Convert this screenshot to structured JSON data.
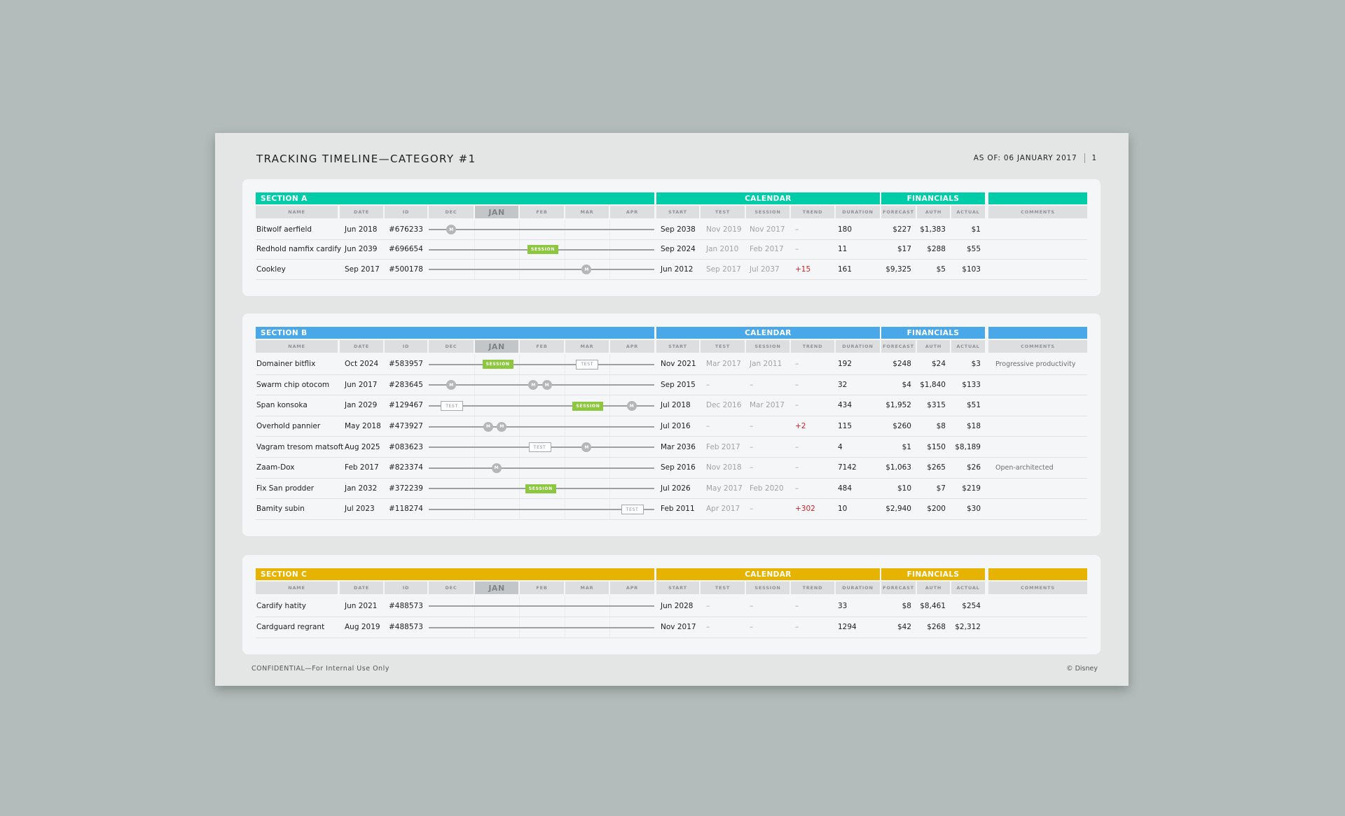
{
  "header": {
    "title": "TRACKING TIMELINE—CATEGORY #1",
    "as_of": "AS OF: 06 JANUARY 2017",
    "page_number": "1"
  },
  "group_headers": {
    "calendar": "CALENDAR",
    "financials": "FINANCIALS"
  },
  "columns": {
    "name": "NAME",
    "date": "DATE",
    "id": "ID",
    "months": [
      "DEC",
      "JAN",
      "FEB",
      "MAR",
      "APR"
    ],
    "start": "START",
    "test": "TEST",
    "session": "SESSION",
    "trend": "TREND",
    "duration": "DURATION",
    "forecast": "FORECAST",
    "auth": "AUTH",
    "actual": "ACTUAL",
    "comments": "COMMENTS"
  },
  "milestone_labels": {
    "m": "M",
    "session": "SESSION",
    "test": "TEST"
  },
  "sections": [
    {
      "title": "SECTION A",
      "color": "#00cca8",
      "rows": [
        {
          "name": "Bitwolf aerfield",
          "date": "Jun 2018",
          "id": "#676233",
          "markers": [
            {
              "type": "m",
              "month_pos": 0.5
            }
          ],
          "start": "Sep 2038",
          "test": "Nov 2019",
          "session": "Nov 2017",
          "trend": "–",
          "trend_alert": false,
          "duration": "180",
          "forecast": "$227",
          "auth": "$1,383",
          "actual": "$1",
          "comments": ""
        },
        {
          "name": "Redhold namfix cardify",
          "date": "Jun 2039",
          "id": "#696654",
          "markers": [
            {
              "type": "session",
              "month_pos": 2.5
            }
          ],
          "start": "Sep 2024",
          "test": "Jan 2010",
          "session": "Feb 2017",
          "trend": "–",
          "trend_alert": false,
          "duration": "11",
          "forecast": "$17",
          "auth": "$288",
          "actual": "$55",
          "comments": ""
        },
        {
          "name": "Cookley",
          "date": "Sep 2017",
          "id": "#500178",
          "markers": [
            {
              "type": "m",
              "month_pos": 3.5
            }
          ],
          "start": "Jun 2012",
          "test": "Sep 2017",
          "session": "Jul 2037",
          "trend": "+15",
          "trend_alert": true,
          "duration": "161",
          "forecast": "$9,325",
          "auth": "$5",
          "actual": "$103",
          "comments": ""
        }
      ]
    },
    {
      "title": "SECTION B",
      "color": "#4aa7e8",
      "rows": [
        {
          "name": "Domainer bitflix",
          "date": "Oct 2024",
          "id": "#583957",
          "markers": [
            {
              "type": "session",
              "month_pos": 1.5
            },
            {
              "type": "test",
              "month_pos": 3.5
            }
          ],
          "start": "Nov 2021",
          "test": "Mar 2017",
          "session": "Jan 2011",
          "trend": "–",
          "trend_alert": false,
          "duration": "192",
          "forecast": "$248",
          "auth": "$24",
          "actual": "$3",
          "comments": "Progressive productivity"
        },
        {
          "name": "Swarm chip otocom",
          "date": "Jun 2017",
          "id": "#283645",
          "markers": [
            {
              "type": "m",
              "month_pos": 0.5
            },
            {
              "type": "m",
              "month_pos": 2.32
            },
            {
              "type": "m",
              "month_pos": 2.62
            }
          ],
          "start": "Sep 2015",
          "test": "–",
          "session": "–",
          "trend": "–",
          "trend_alert": false,
          "duration": "32",
          "forecast": "$4",
          "auth": "$1,840",
          "actual": "$133",
          "comments": ""
        },
        {
          "name": "Span konsoka",
          "date": "Jan 2029",
          "id": "#129467",
          "markers": [
            {
              "type": "test",
              "month_pos": 0.5
            },
            {
              "type": "session",
              "month_pos": 3.5
            },
            {
              "type": "m",
              "month_pos": 4.5
            }
          ],
          "start": "Jul 2018",
          "test": "Dec 2016",
          "session": "Mar 2017",
          "trend": "–",
          "trend_alert": false,
          "duration": "434",
          "forecast": "$1,952",
          "auth": "$315",
          "actual": "$51",
          "comments": ""
        },
        {
          "name": "Overhold pannier",
          "date": "May 2018",
          "id": "#473927",
          "markers": [
            {
              "type": "m",
              "month_pos": 1.32
            },
            {
              "type": "m",
              "month_pos": 1.62
            }
          ],
          "start": "Jul 2016",
          "test": "–",
          "session": "–",
          "trend": "+2",
          "trend_alert": true,
          "duration": "115",
          "forecast": "$260",
          "auth": "$8",
          "actual": "$18",
          "comments": ""
        },
        {
          "name": "Vagram tresom matsoft",
          "date": "Aug 2025",
          "id": "#083623",
          "markers": [
            {
              "type": "test",
              "month_pos": 2.45
            },
            {
              "type": "m",
              "month_pos": 3.5
            }
          ],
          "start": "Mar 2036",
          "test": "Feb 2017",
          "session": "–",
          "trend": "–",
          "trend_alert": false,
          "duration": "4",
          "forecast": "$1",
          "auth": "$150",
          "actual": "$8,189",
          "comments": ""
        },
        {
          "name": "Zaam-Dox",
          "date": "Feb 2017",
          "id": "#823374",
          "markers": [
            {
              "type": "m",
              "month_pos": 1.5
            }
          ],
          "start": "Sep 2016",
          "test": "Nov 2018",
          "session": "–",
          "trend": "–",
          "trend_alert": false,
          "duration": "7142",
          "forecast": "$1,063",
          "auth": "$265",
          "actual": "$26",
          "comments": "Open-architected"
        },
        {
          "name": "Fix San prodder",
          "date": "Jan 2032",
          "id": "#372239",
          "markers": [
            {
              "type": "session",
              "month_pos": 2.45
            }
          ],
          "start": "Jul 2026",
          "test": "May 2017",
          "session": "Feb 2020",
          "trend": "–",
          "trend_alert": false,
          "duration": "484",
          "forecast": "$10",
          "auth": "$7",
          "actual": "$219",
          "comments": ""
        },
        {
          "name": "Bamity subin",
          "date": "Jul 2023",
          "id": "#118274",
          "markers": [
            {
              "type": "test",
              "month_pos": 4.5
            }
          ],
          "start": "Feb 2011",
          "test": "Apr 2017",
          "session": "–",
          "trend": "+302",
          "trend_alert": true,
          "duration": "10",
          "forecast": "$2,940",
          "auth": "$200",
          "actual": "$30",
          "comments": ""
        }
      ]
    },
    {
      "title": "SECTION C",
      "color": "#e6b400",
      "rows": [
        {
          "name": "Cardify hatity",
          "date": "Jun 2021",
          "id": "#488573",
          "markers": [],
          "start": "Jun 2028",
          "test": "–",
          "session": "–",
          "trend": "–",
          "trend_alert": false,
          "duration": "33",
          "forecast": "$8",
          "auth": "$8,461",
          "actual": "$254",
          "comments": ""
        },
        {
          "name": "Cardguard regrant",
          "date": "Aug 2019",
          "id": "#488573",
          "markers": [],
          "start": "Nov 2017",
          "test": "–",
          "session": "–",
          "trend": "–",
          "trend_alert": false,
          "duration": "1294",
          "forecast": "$42",
          "auth": "$268",
          "actual": "$2,312",
          "comments": ""
        }
      ]
    }
  ],
  "footer": {
    "left": "CONFIDENTIAL—For Internal Use Only",
    "right": "© Disney"
  }
}
